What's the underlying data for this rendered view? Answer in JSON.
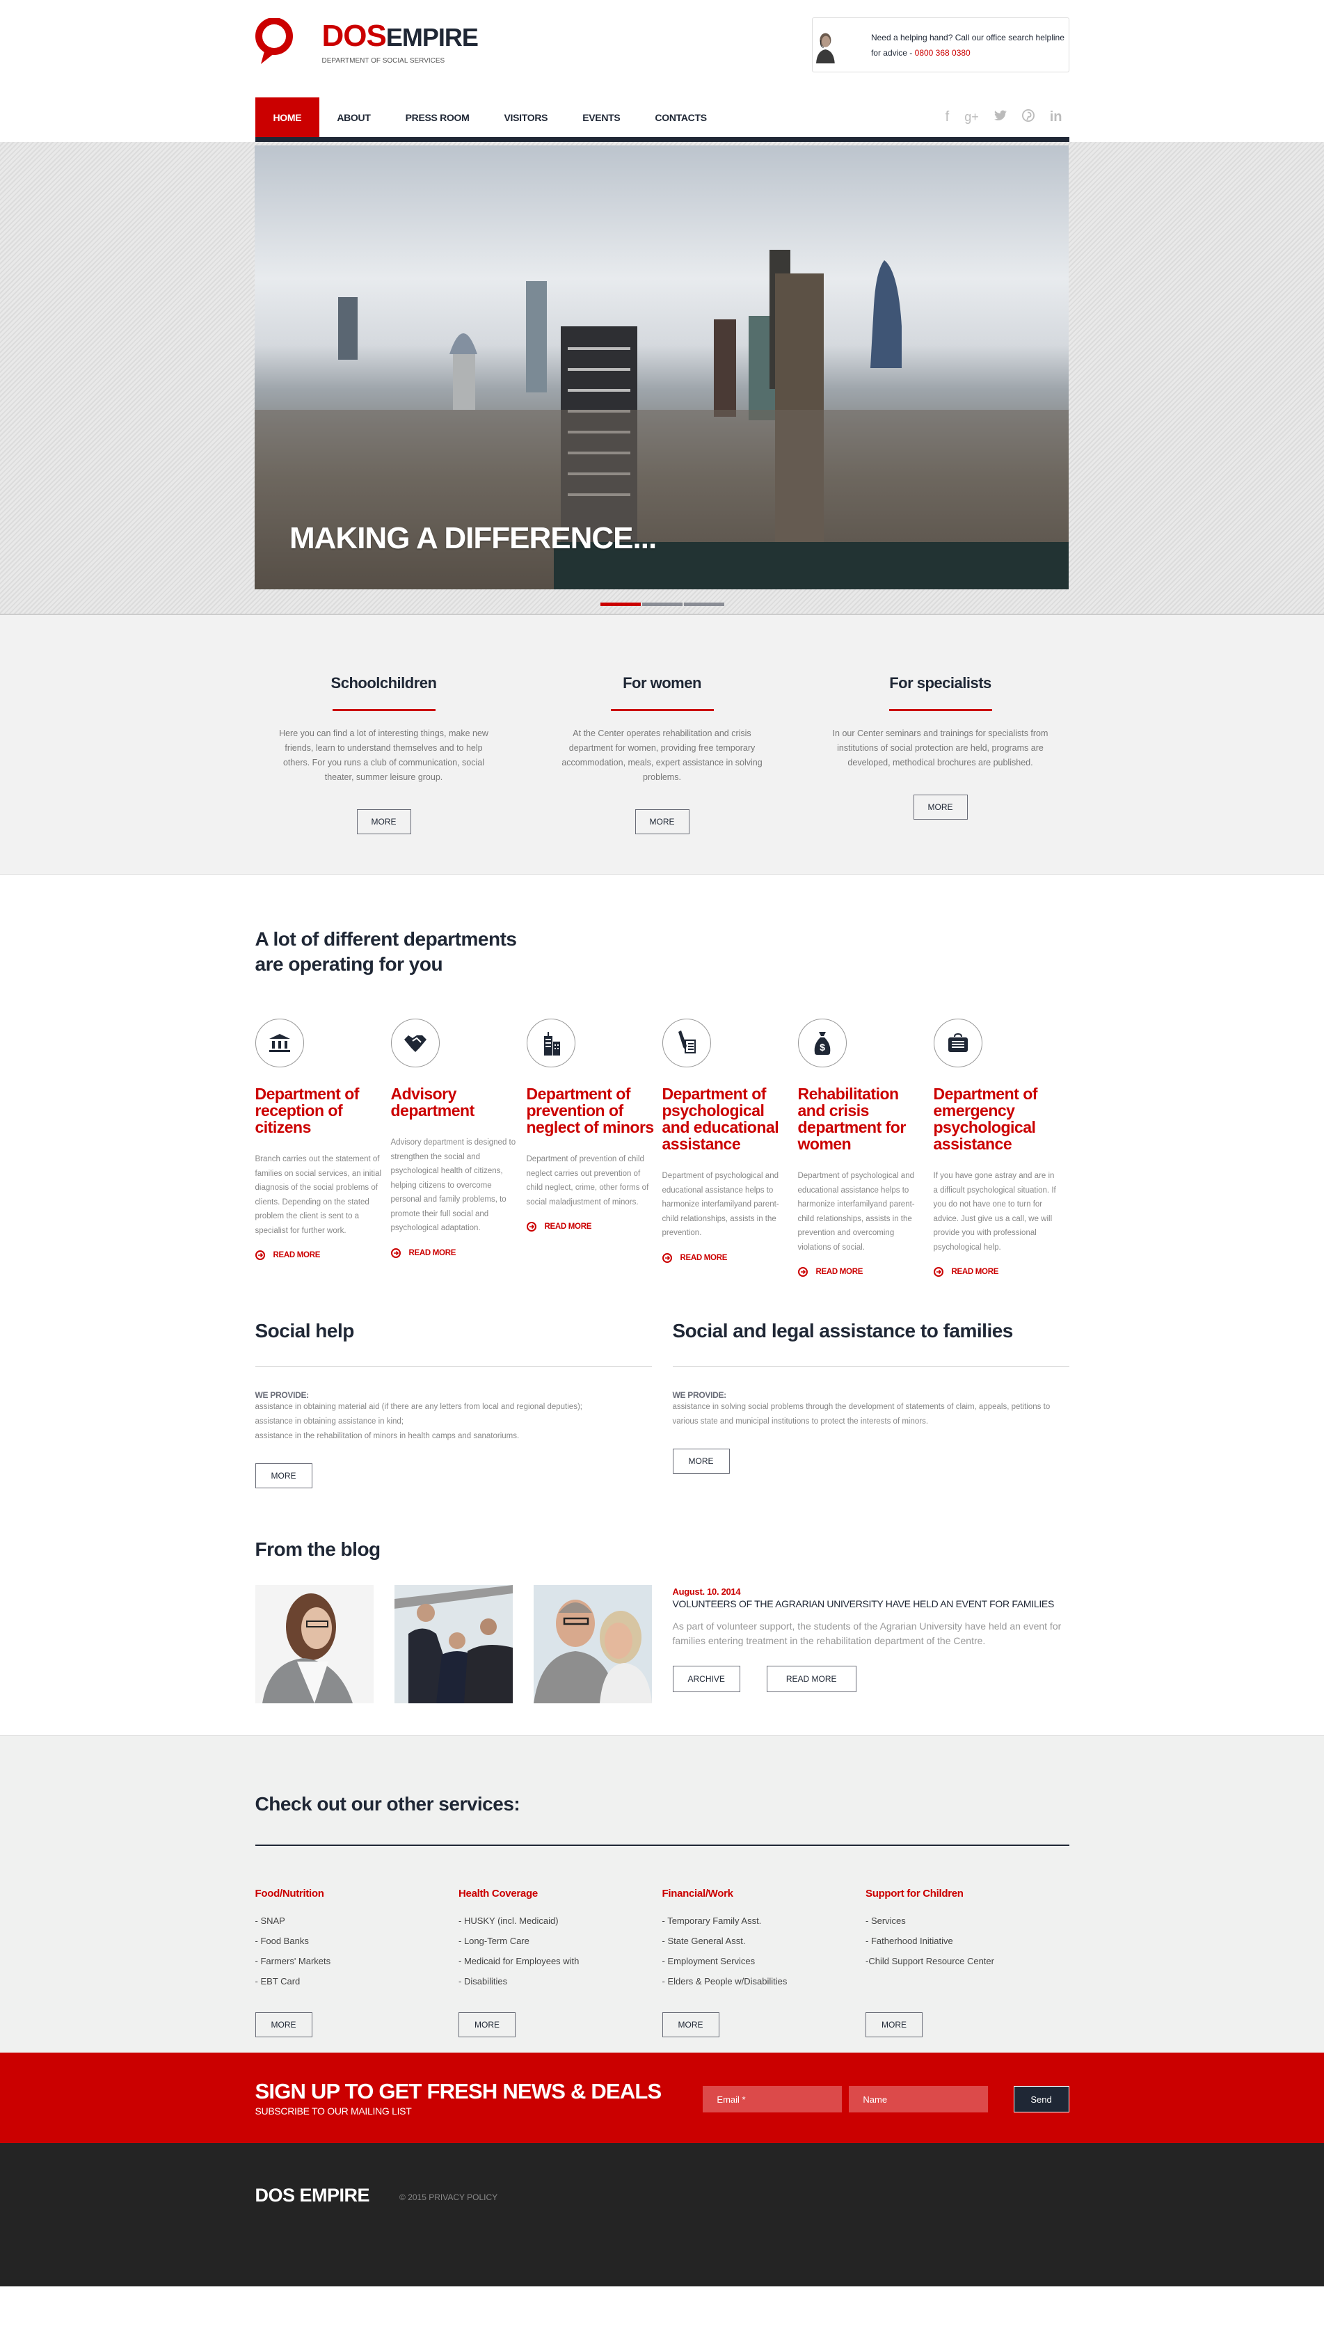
{
  "header": {
    "brand_red": "DOS",
    "brand_dark": "EMPIRE",
    "tagline": "DEPARTMENT OF SOCIAL SERVICES",
    "helpline_text": "Need a helping hand? Call our office search helpline for advice - ",
    "helpline_phone": "0800 368 0380"
  },
  "nav": {
    "items": [
      {
        "label": "HOME",
        "active": true
      },
      {
        "label": "ABOUT"
      },
      {
        "label": "PRESS ROOM"
      },
      {
        "label": "VISITORS"
      },
      {
        "label": "EVENTS"
      },
      {
        "label": "CONTACTS"
      }
    ],
    "social": [
      "facebook-icon",
      "google-plus-icon",
      "twitter-icon",
      "pinterest-icon",
      "linkedin-icon"
    ]
  },
  "hero": {
    "title": "MAKING A DIFFERENCE...",
    "slides": 3,
    "active_slide": 1
  },
  "audience": [
    {
      "title": "Schoolchildren",
      "text": "Here you can find a lot of interesting things, make new friends, learn to understand themselves and to help others. For you runs a club of communication, social theater, summer leisure group.",
      "button": "MORE"
    },
    {
      "title": "For women",
      "text": "At the Center  operates rehabilitation and crisis department for women, providing free temporary accommodation, meals, expert assistance in solving problems.",
      "button": "MORE"
    },
    {
      "title": "For specialists",
      "text": "In our Center seminars and trainings for specialists from institutions of social protection are held, programs are developed, methodical brochures are published.",
      "button": "MORE"
    }
  ],
  "departments": {
    "title_line1": "A lot of different departments",
    "title_line2": "are operating for you",
    "read_more": "READ MORE",
    "items": [
      {
        "icon": "bank-icon",
        "title": "Department of reception of citizens",
        "text": "Branch carries out the statement of families on social services, an initial diagnosis of the social problems of clients. Depending on the stated problem the client is sent to a specialist for further work."
      },
      {
        "icon": "handshake-icon",
        "title": "Advisory department",
        "text": "Advisory department is designed to strengthen the social and psychological health of citizens, helping citizens to overcome personal and family problems, to promote their full social and psychological adaptation."
      },
      {
        "icon": "buildings-icon",
        "title": "Department of prevention of neglect of minors",
        "text": "Department of prevention of child neglect carries out prevention of child neglect, crime, other forms of social maladjustment of minors."
      },
      {
        "icon": "pen-document-icon",
        "title": "Department of psychological and educational assistance",
        "text": "Department of psychological and educational assistance helps to harmonize interfamilyand parent-child relationships, assists in the prevention."
      },
      {
        "icon": "money-bag-icon",
        "title": "Rehabilitation and crisis department for women",
        "text": "Department of psychological and educational assistance helps to harmonize interfamilyand parent-child relationships, assists in the prevention and overcoming violations of social."
      },
      {
        "icon": "briefcase-icon",
        "title": "Department of emergency psychological assistance",
        "text": "If you have gone astray and are in a difficult psychological situation. If you do not have one to turn for advice. Just give us a call, we will provide you with professional psychological help."
      }
    ]
  },
  "help": [
    {
      "title": "Social help",
      "provide": "WE PROVIDE:",
      "lines": [
        "assistance in obtaining material aid (if there are any letters from local and regional deputies);",
        "assistance in obtaining assistance in kind;",
        "assistance in the rehabilitation of minors in health camps and sanatoriums."
      ],
      "button": "MORE"
    },
    {
      "title": "Social and legal assistance to families",
      "provide": "WE PROVIDE:",
      "lines": [
        "assistance in solving social problems through the development of statements of claim, appeals, petitions to various state and municipal institutions to protect the interests of minors."
      ],
      "button": "MORE"
    }
  ],
  "blog": {
    "title": "From the blog",
    "thumbs": [
      "woman-with-glasses-photo",
      "business-handshake-photo",
      "smiling-couple-photo"
    ],
    "date": "August. 10. 2014",
    "post_title": "VOLUNTEERS OF THE AGRARIAN UNIVERSITY HAVE HELD AN EVENT FOR FAMILIES",
    "post_text": "As part of  volunteer support, the students of the Agrarian University have held an event for families entering treatment in the rehabilitation department of the Centre.",
    "archive": "ARCHIVE",
    "read_more": "READ MORE"
  },
  "services": {
    "title": "Check out our other services:",
    "button": "MORE",
    "columns": [
      {
        "title": "Food/Nutrition",
        "items": [
          "- SNAP",
          "- Food Banks",
          "- Farmers' Markets",
          "- EBT Card"
        ]
      },
      {
        "title": "Health Coverage",
        "items": [
          "- HUSKY (incl. Medicaid)",
          "- Long-Term Care",
          "- Medicaid for Employees with",
          "- Disabilities"
        ]
      },
      {
        "title": "Financial/Work",
        "items": [
          "- Temporary Family Asst.",
          "- State General Asst.",
          "- Employment Services",
          "- Elders & People w/Disabilities"
        ]
      },
      {
        "title": "Support for Children",
        "items": [
          "- Services",
          "- Fatherhood Initiative",
          "-Child Support Resource Center"
        ]
      }
    ]
  },
  "signup": {
    "title": "SIGN UP TO GET FRESH NEWS & DEALS",
    "subtitle": "SUBSCRIBE TO OUR MAILING LIST",
    "email_placeholder": "Email *",
    "name_placeholder": "Name",
    "send": "Send"
  },
  "footer": {
    "brand": "DOS EMPIRE",
    "copyright": "© 2015",
    "privacy": "PRIVACY POLICY"
  },
  "colors": {
    "accent": "#cb0000",
    "dark": "#1f2735",
    "footer": "#242424"
  }
}
